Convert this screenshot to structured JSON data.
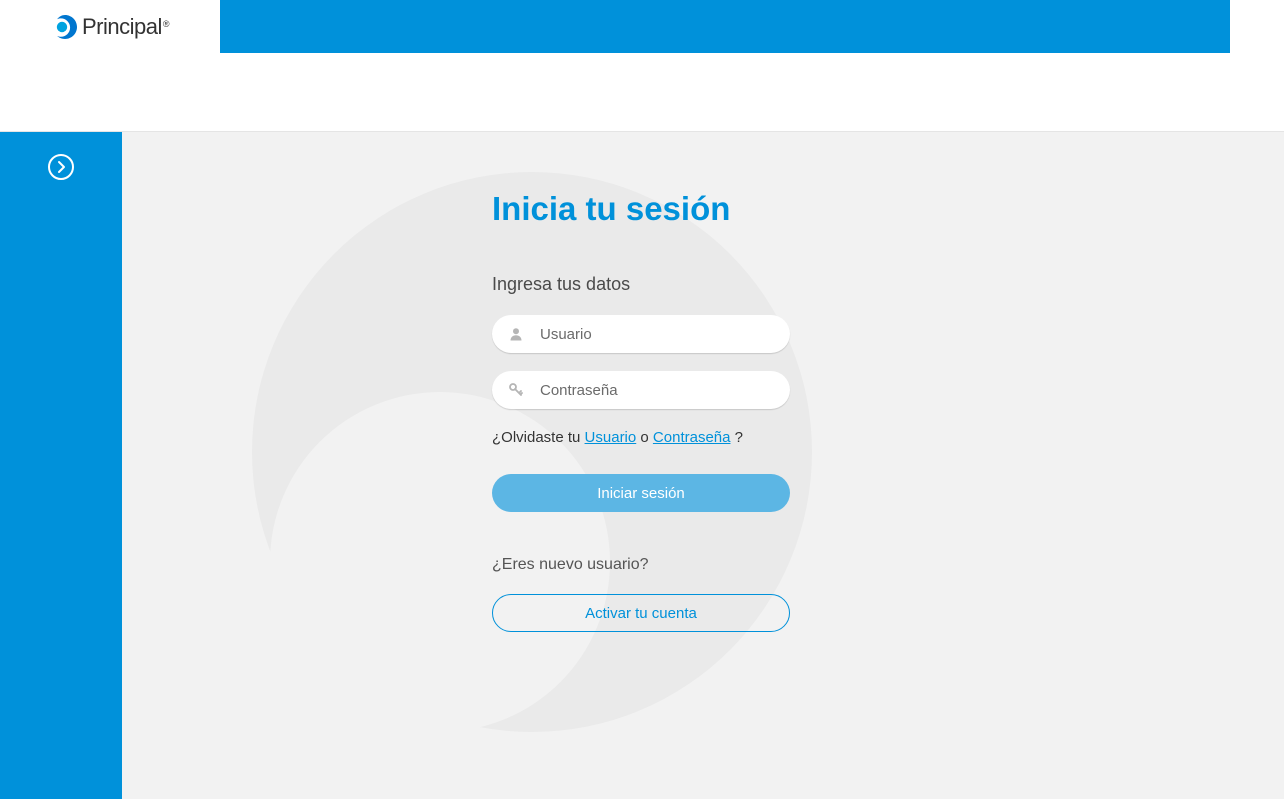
{
  "brand": {
    "name": "Principal",
    "registered_mark": "®"
  },
  "login": {
    "title": "Inicia tu sesión",
    "subtitle": "Ingresa tus datos",
    "username_placeholder": "Usuario",
    "password_placeholder": "Contraseña",
    "forgot_prefix": "¿Olvidaste tu ",
    "forgot_user_link": "Usuario",
    "forgot_separator": " o ",
    "forgot_password_link": "Contraseña",
    "forgot_suffix": " ?",
    "submit_label": "Iniciar sesión",
    "new_user_title": "¿Eres nuevo usuario?",
    "activate_label": "Activar tu cuenta"
  }
}
